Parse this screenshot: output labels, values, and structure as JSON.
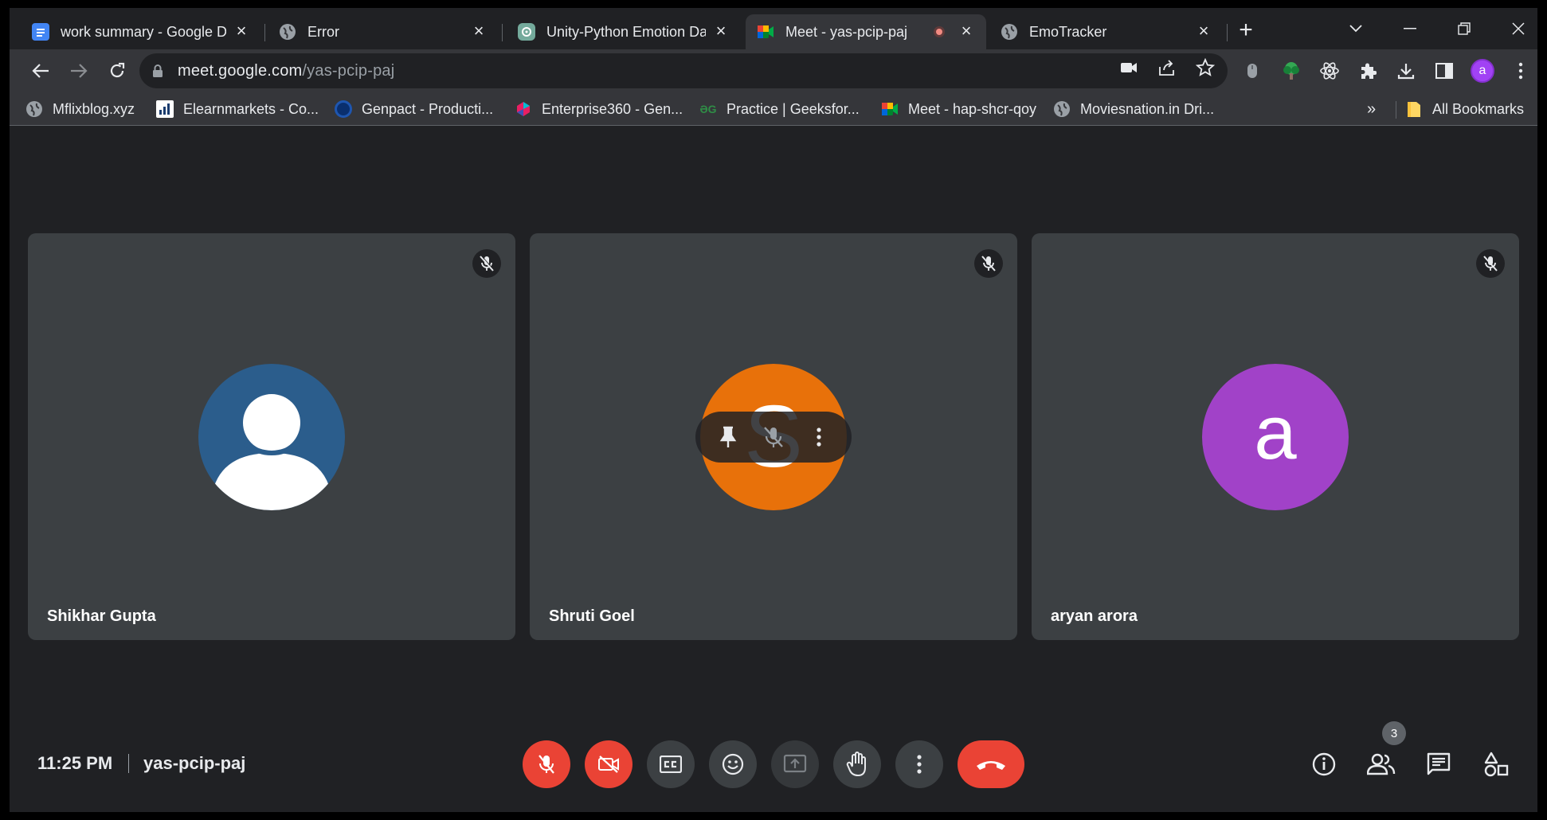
{
  "tabs": [
    {
      "title": "work summary - Google D",
      "favicon": "google-docs-icon"
    },
    {
      "title": "Error",
      "favicon": "globe-icon"
    },
    {
      "title": "Unity-Python Emotion Da",
      "favicon": "chatgpt-icon"
    },
    {
      "title": "Meet - yas-pcip-paj",
      "favicon": "google-meet-icon",
      "active": true,
      "recording": true
    },
    {
      "title": "EmoTracker",
      "favicon": "globe-icon"
    }
  ],
  "address_bar": {
    "host": "meet.google.com",
    "path": "/yas-pcip-paj"
  },
  "profile_initial": "a",
  "bookmarks": [
    {
      "label": "Mflixblog.xyz",
      "icon": "globe-icon"
    },
    {
      "label": "Elearnmarkets - Co...",
      "icon": "elm-icon"
    },
    {
      "label": "Genpact - Producti...",
      "icon": "genpact-icon"
    },
    {
      "label": "Enterprise360 - Gen...",
      "icon": "enterprise360-icon"
    },
    {
      "label": "Practice | Geeksfor...",
      "icon": "geeksforgeeks-icon"
    },
    {
      "label": "Meet - hap-shcr-qoy",
      "icon": "google-meet-icon"
    },
    {
      "label": "Moviesnation.in Dri...",
      "icon": "globe-icon"
    }
  ],
  "bookmarks_overflow": "»",
  "all_bookmarks": "All Bookmarks",
  "participants": [
    {
      "name": "Shikhar Gupta",
      "avatar": "default-user",
      "avatar_color": "#2b5d8c",
      "muted": true
    },
    {
      "name": "Shruti Goel",
      "avatar": "S",
      "avatar_color": "#e8710a",
      "muted": true,
      "hovered": true
    },
    {
      "name": "aryan arora",
      "avatar": "a",
      "avatar_color": "#a142c8",
      "muted": true
    }
  ],
  "meeting": {
    "time": "11:25 PM",
    "code": "yas-pcip-paj",
    "participant_count": "3"
  },
  "colors": {
    "end_call": "#ea4335",
    "tile": "#3c4043",
    "background": "#202124"
  }
}
